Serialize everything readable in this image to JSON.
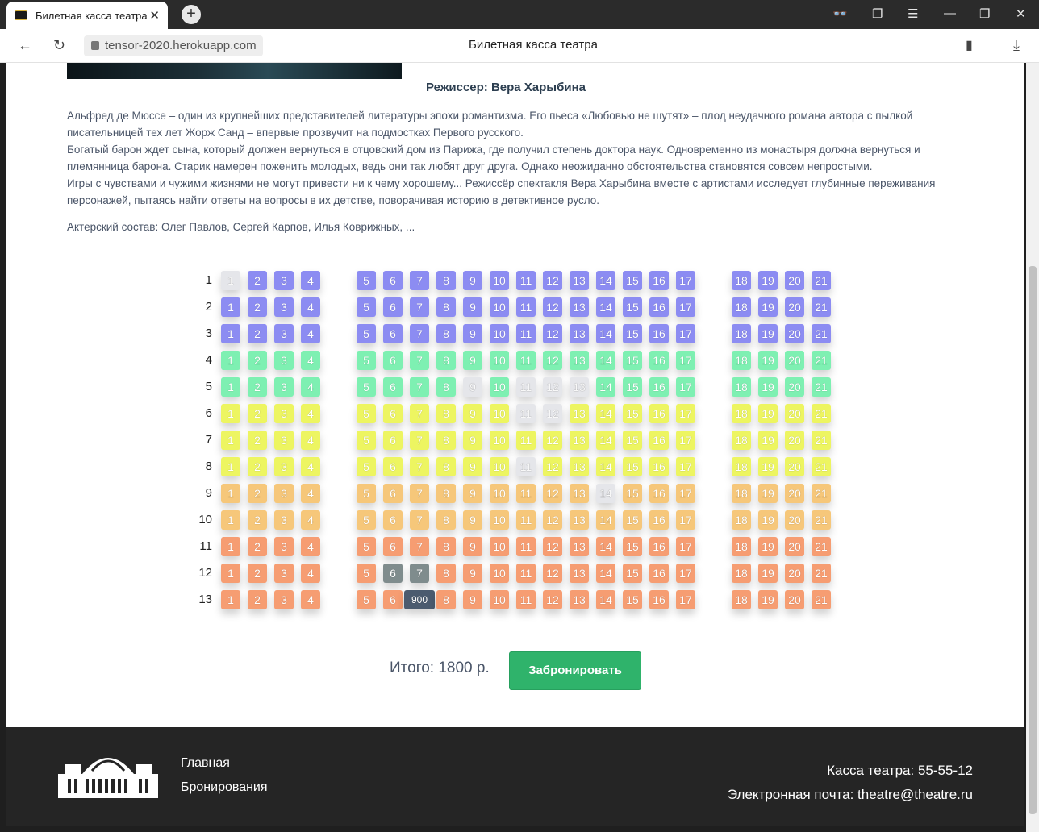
{
  "browser": {
    "tab_title": "Билетная касса театра",
    "url": "tensor-2020.herokuapp.com",
    "page_title": "Билетная касса театра"
  },
  "show": {
    "director": "Режиссер: Вера Харыбина",
    "description": [
      "Альфред де Мюссе – один из крупнейших представителей литературы эпохи романтизма. Его пьеса «Любовью не шутят» – плод неудачного романа автора с пылкой писательницей тех лет Жорж Санд – впервые прозвучит на подмостках Первого русского.",
      "Богатый барон ждет сына, который должен вернуться в отцовский дом из Парижа, где получил степень доктора наук. Одновременно из монастыря должна вернуться и племянница барона. Старик намерен поженить молодых, ведь они так любят друг друга. Однако неожиданно обстоятельства становятся совсем непростыми.",
      "Игры с чувствами и чужими жизнями не могут привести ни к чему хорошему... Режиссёр спектакля Вера Харыбина вместе с артистами исследует глубинные переживания персонажей, пытаясь найти ответы на вопросы в их детстве, поворачивая историю в детективное русло."
    ],
    "cast": "Актерский состав: Олег Павлов, Сергей Карпов, Илья Коврижных, ..."
  },
  "hall": {
    "seats_per_row": 21,
    "row_colors": [
      "purple",
      "purple",
      "purple",
      "green",
      "green",
      "yellow",
      "yellow",
      "yellow",
      "orange",
      "orange",
      "red",
      "red",
      "red"
    ],
    "taken": {
      "1": [
        1
      ],
      "5": [
        9,
        11,
        12,
        13
      ],
      "6": [
        11,
        12
      ],
      "8": [
        11
      ],
      "9": [
        14
      ]
    },
    "selected": {
      "12": [
        6,
        7
      ]
    },
    "price_tooltip": {
      "row": 13,
      "seat": 7,
      "text": "900"
    }
  },
  "booking": {
    "total": "Итого: 1800 р.",
    "button": "Забронировать"
  },
  "footer": {
    "links": [
      "Главная",
      "Бронирования"
    ],
    "phone": "Касса театра: 55-55-12",
    "email": "Электронная почта: theatre@theatre.ru"
  }
}
